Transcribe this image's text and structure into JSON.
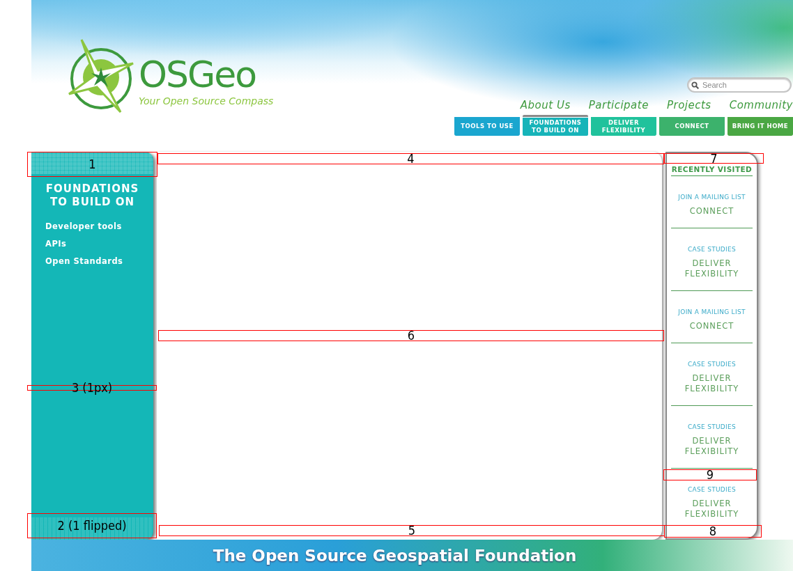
{
  "logo": {
    "name": "OSGeo",
    "tagline": "Your Open Source Compass"
  },
  "search": {
    "placeholder": "Search"
  },
  "nav_links": [
    "About Us",
    "Participate",
    "Projects",
    "Community"
  ],
  "tabs": [
    {
      "label": "TOOLS TO USE",
      "selected": false,
      "color": "#1aa6cf"
    },
    {
      "label": "FOUNDATIONS TO BUILD ON",
      "selected": true,
      "color": "#17b4b9"
    },
    {
      "label": "DELIVER FLEXIBILITY",
      "selected": false,
      "color": "#20c29c"
    },
    {
      "label": "CONNECT",
      "selected": false,
      "color": "#3cb26c"
    },
    {
      "label": "BRING IT HOME",
      "selected": false,
      "color": "#4aa743"
    }
  ],
  "sidebar": {
    "title": "FOUNDATIONS TO BUILD ON",
    "items": [
      "Developer tools",
      "APIs",
      "Open Standards"
    ]
  },
  "recently_visited": {
    "title": "RECENTLY VISITED",
    "items": [
      {
        "category": "JOIN A MAILING LIST",
        "title": "CONNECT"
      },
      {
        "category": "CASE STUDIES",
        "title": "DELIVER FLEXIBILITY"
      },
      {
        "category": "JOIN A MAILING LIST",
        "title": "CONNECT"
      },
      {
        "category": "CASE STUDIES",
        "title": "DELIVER FLEXIBILITY"
      },
      {
        "category": "CASE STUDIES",
        "title": "DELIVER FLEXIBILITY"
      },
      {
        "category": "CASE STUDIES",
        "title": "DELIVER FLEXIBILITY"
      }
    ]
  },
  "footer": {
    "text": "The Open Source Geospatial Foundation"
  },
  "annotations": [
    {
      "label": "1"
    },
    {
      "label": "4"
    },
    {
      "label": "7"
    },
    {
      "label": "6"
    },
    {
      "label": "3 (1px)"
    },
    {
      "label": "9"
    },
    {
      "label": "2 (1 flipped)"
    },
    {
      "label": "5"
    },
    {
      "label": "8"
    }
  ]
}
